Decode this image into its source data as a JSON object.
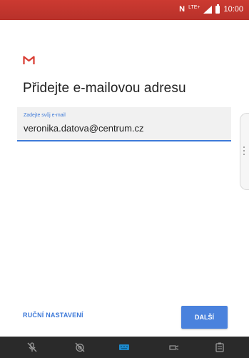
{
  "status_bar": {
    "network": "N",
    "lte": "LTE+",
    "time": "10:00",
    "color": "#c4352d"
  },
  "title": "Přidejte e-mailovou adresu",
  "email_field": {
    "label": "Zadejte svůj e-mail",
    "value": "veronika.datova@centrum.cz"
  },
  "actions": {
    "manual_label": "RUČNÍ NASTAVENÍ",
    "next_label": "DALŠÍ",
    "accent": "#3d79d8"
  },
  "nav_bar": {
    "icons": [
      "mic-off-icon",
      "camera-off-icon",
      "keyboard-icon",
      "cast-icon",
      "clipboard-icon"
    ]
  }
}
